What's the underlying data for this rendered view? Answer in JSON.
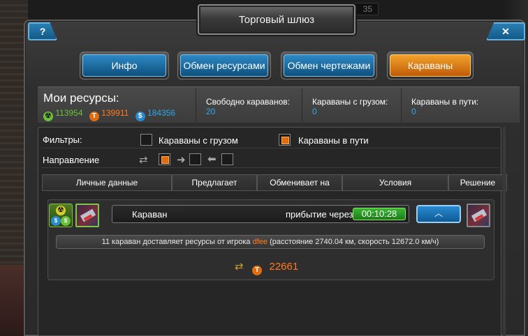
{
  "window": {
    "title": "Торговый шлюз",
    "help_label": "?",
    "close_label": "✕",
    "top_counter": "35"
  },
  "tabs": [
    {
      "label": "Инфо",
      "active": false
    },
    {
      "label": "Обмен ресурсами",
      "active": false
    },
    {
      "label": "Обмен чертежами",
      "active": false
    },
    {
      "label": "Караваны",
      "active": true
    }
  ],
  "resources": {
    "title": "Мои ресурсы:",
    "items": [
      {
        "icon": "radiation-icon",
        "value": "113954",
        "color": "#6bc23a"
      },
      {
        "icon": "titanium-icon",
        "value": "139911",
        "color": "#ff7a1a"
      },
      {
        "icon": "credits-icon",
        "value": "184356",
        "color": "#2fa8e8"
      }
    ]
  },
  "stats": [
    {
      "title": "Свободно караванов:",
      "value": "20"
    },
    {
      "title": "Караваны с грузом:",
      "value": "0"
    },
    {
      "title": "Караваны в пути:",
      "value": "0"
    }
  ],
  "filters": {
    "label": "Фильтры:",
    "options": [
      {
        "label": "Караваны с грузом",
        "checked": false
      },
      {
        "label": "Караваны в пути",
        "checked": true
      }
    ],
    "direction_label": "Направление",
    "direction": {
      "both": true,
      "outgoing": false,
      "incoming": false
    }
  },
  "table_headers": [
    "Личные данные",
    "Предлагает",
    "Обменивает на",
    "Условия",
    "Решение"
  ],
  "caravan": {
    "name": "Караван",
    "arrival_label": "прибытие через",
    "timer": "00:10:28",
    "expand_icon": "chevron-up-icon",
    "info_prefix": "11 караван доставляет ресурсы от игрока",
    "player": "dfee",
    "info_suffix": "(расстояние 2740.04 км, скорость 12672.0 км/ч)",
    "cargo_icon": "titanium-icon",
    "cargo_amount": "22661"
  },
  "colors": {
    "accent_blue": "#2fa8e8",
    "accent_orange": "#ff7a1a",
    "accent_green": "#6bc23a"
  }
}
